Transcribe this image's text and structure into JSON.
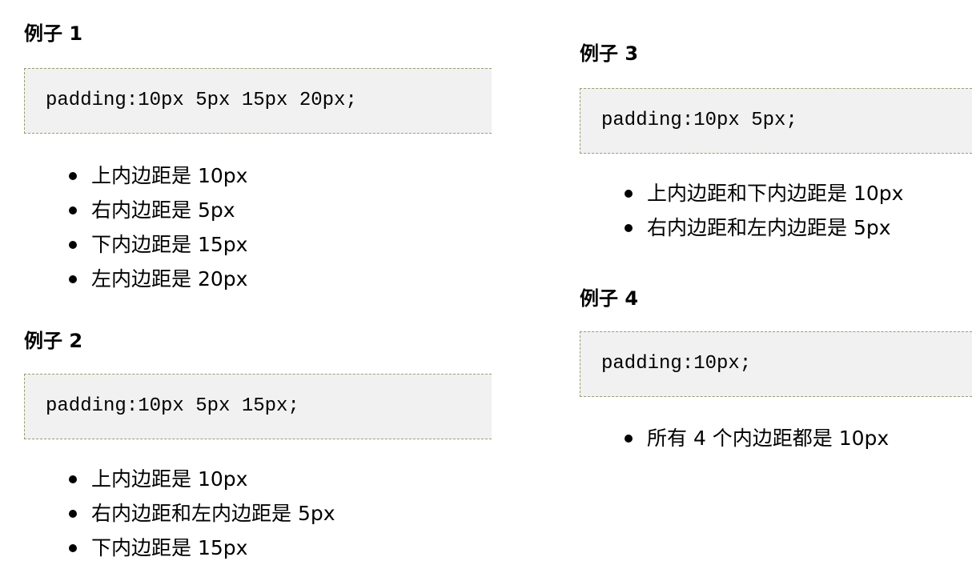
{
  "examples": [
    {
      "title": "例子 1",
      "code": "padding:10px 5px 15px 20px;",
      "points": [
        "上内边距是 10px",
        "右内边距是 5px",
        "下内边距是 15px",
        "左内边距是 20px"
      ]
    },
    {
      "title": "例子 2",
      "code": "padding:10px 5px 15px;",
      "points": [
        "上内边距是 10px",
        "右内边距和左内边距是 5px",
        "下内边距是 15px"
      ]
    },
    {
      "title": "例子 3",
      "code": "padding:10px 5px;",
      "points": [
        "上内边距和下内边距是 10px",
        "右内边距和左内边距是 5px"
      ]
    },
    {
      "title": "例子 4",
      "code": "padding:10px;",
      "points": [
        "所有 4 个内边距都是 10px"
      ]
    }
  ],
  "colors": {
    "code_background": "#f1f1f1",
    "code_border": "#9c9c70",
    "text": "#000000"
  }
}
